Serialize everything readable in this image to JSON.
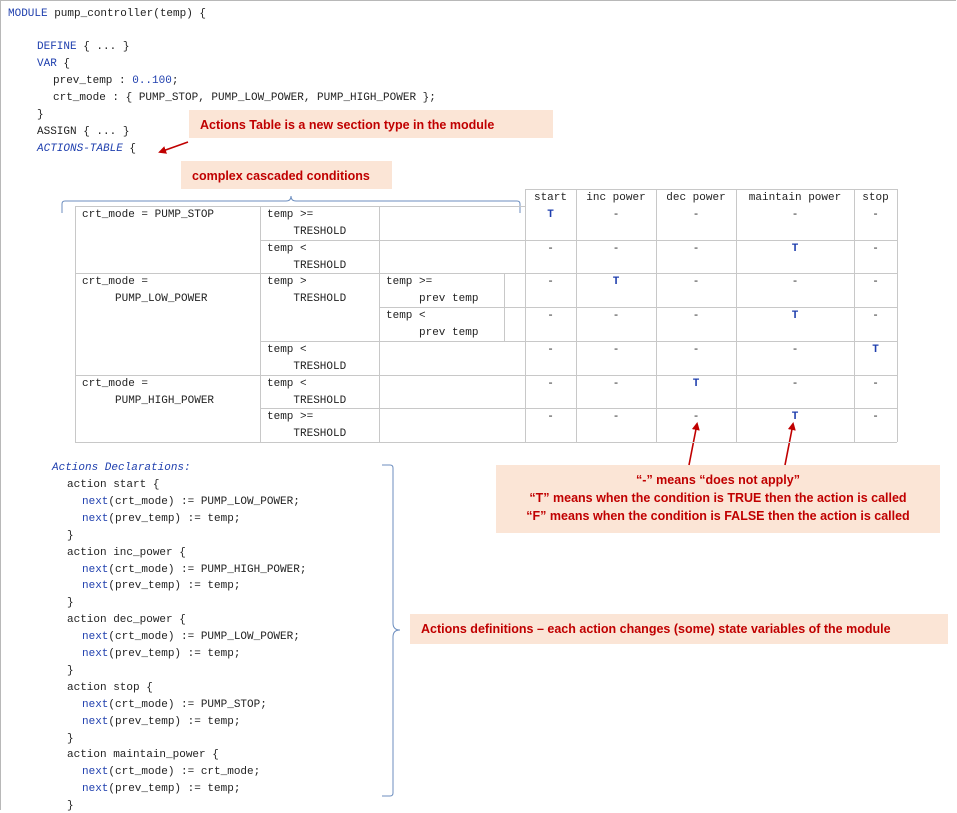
{
  "code": {
    "module_kw": "MODULE",
    "module_sig": " pump_controller(temp) {",
    "define_kw": "DEFINE",
    "define_rest": " { ... }",
    "var_kw": "VAR",
    "var_rest": " {",
    "prev_temp_decl": "prev_temp : ",
    "prev_temp_range": "0..100",
    "prev_temp_end": ";",
    "crt_mode_decl": "crt_mode : { PUMP_STOP, PUMP_LOW_POWER, PUMP_HIGH_POWER };",
    "close_brace": "}",
    "assign_line": "ASSIGN { ... }",
    "actions_table_kw": "ACTIONS-TABLE",
    "actions_table_rest": " {"
  },
  "annotations": {
    "actions_table": "Actions Table is a new section type in the module",
    "cascaded": "complex cascaded conditions",
    "legend_dash": "“-” means “does not apply”",
    "legend_T": "“T” means when the condition is TRUE then the action is called",
    "legend_F": "“F” means when the condition is FALSE then the action is called",
    "definitions": "Actions definitions – each action changes (some) state variables of the module"
  },
  "table": {
    "headers": [
      "start",
      "inc power",
      "dec power",
      "maintain power",
      "stop"
    ],
    "cond1": [
      "crt_mode = PUMP_STOP",
      "crt_mode =\n     PUMP_LOW_POWER",
      "crt_mode =\n     PUMP_HIGH_POWER"
    ],
    "cond2": [
      "temp >=\n    TRESHOLD",
      "temp <\n    TRESHOLD",
      "temp >\n    TRESHOLD",
      "temp <\n    TRESHOLD",
      "temp <\n    TRESHOLD",
      "temp >=\n    TRESHOLD"
    ],
    "cond3": [
      "temp >=\n     prev temp",
      "temp <\n     prev temp"
    ],
    "rows": [
      [
        "T",
        "-",
        "-",
        "-",
        "-"
      ],
      [
        "-",
        "-",
        "-",
        "T",
        "-"
      ],
      [
        "-",
        "T",
        "-",
        "-",
        "-"
      ],
      [
        "-",
        "-",
        "-",
        "T",
        "-"
      ],
      [
        "-",
        "-",
        "-",
        "-",
        "T"
      ],
      [
        "-",
        "-",
        "T",
        "-",
        "-"
      ],
      [
        "-",
        "-",
        "-",
        "T",
        "-"
      ]
    ]
  },
  "actions": {
    "title": "Actions Declarations:",
    "action_kw": "action",
    "next_kw": "next",
    "list": [
      {
        "name": " start {",
        "l1": "(crt_mode) := PUMP_LOW_POWER;",
        "l2": "(prev_temp) := temp;"
      },
      {
        "name": " inc_power {",
        "l1": "(crt_mode) := PUMP_HIGH_POWER;",
        "l2": "(prev_temp) := temp;"
      },
      {
        "name": " dec_power {",
        "l1": "(crt_mode) := PUMP_LOW_POWER;",
        "l2": "(prev_temp) := temp;"
      },
      {
        "name": " stop {",
        "l1": "(crt_mode) := PUMP_STOP;",
        "l2": "(prev_temp) := temp;"
      },
      {
        "name": " maintain_power {",
        "l1": "(crt_mode) := crt_mode;",
        "l2": "(prev_temp) := temp;"
      }
    ],
    "close": "}"
  }
}
